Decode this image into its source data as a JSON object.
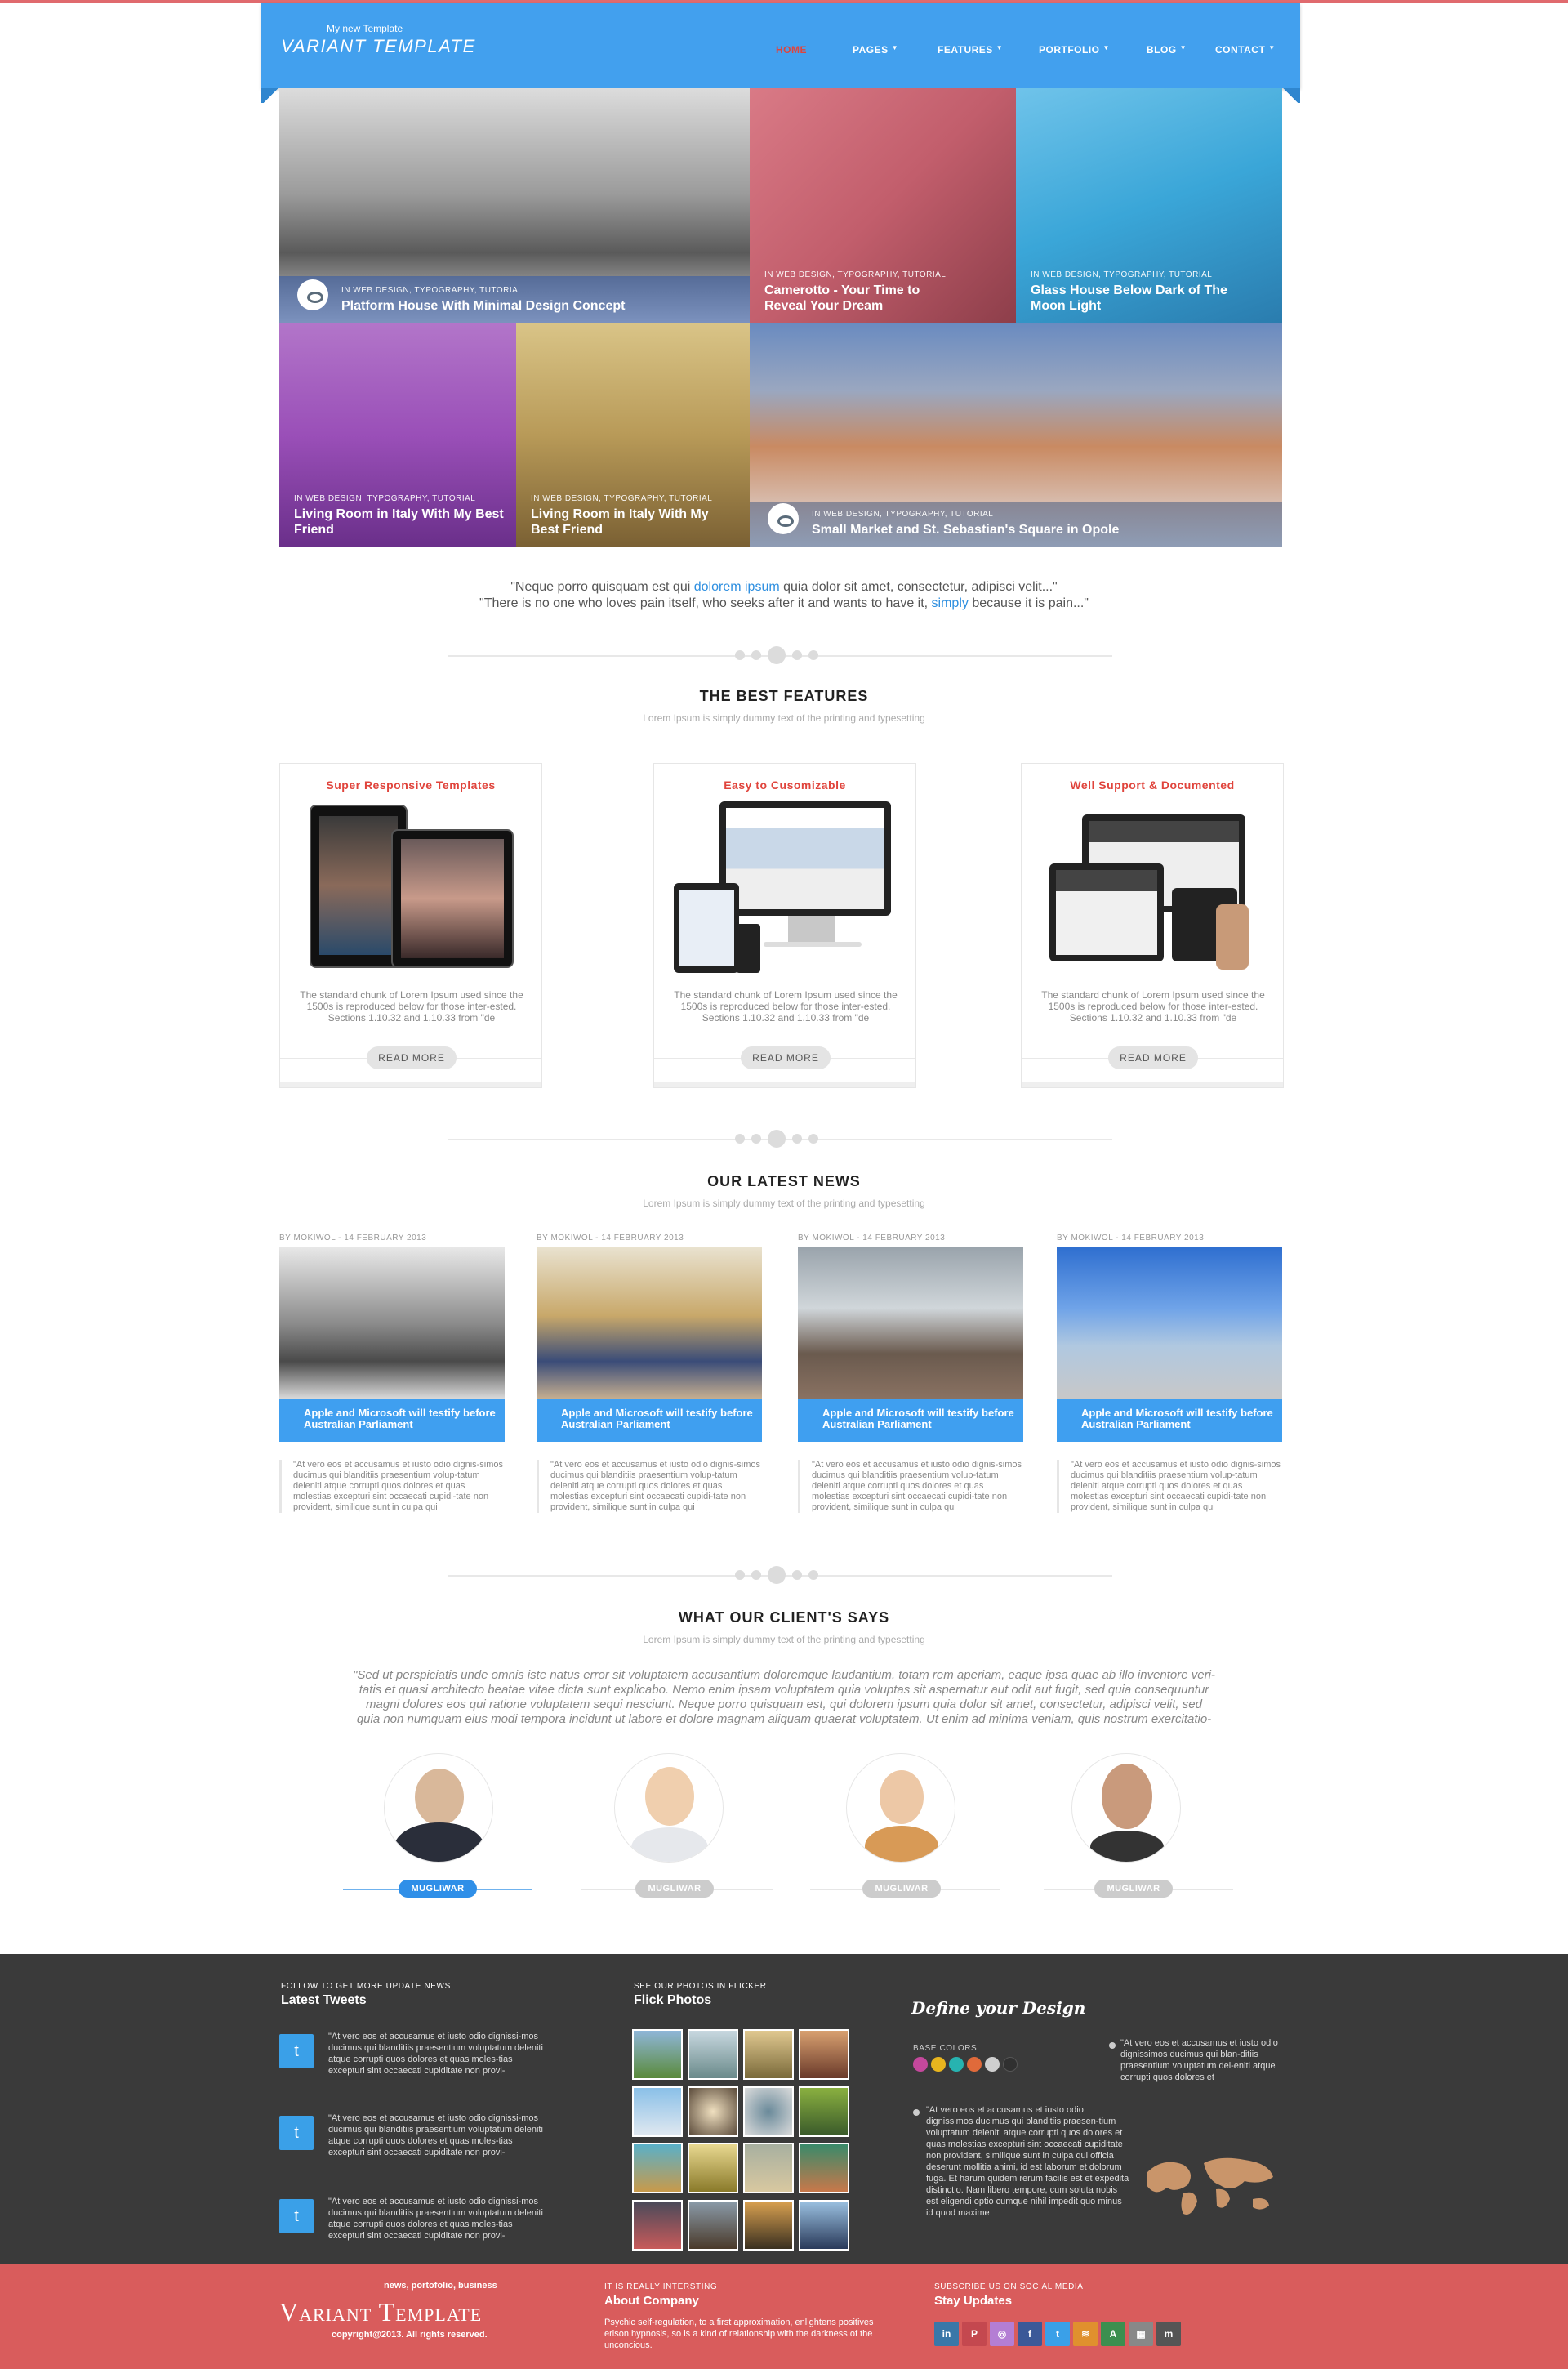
{
  "header": {
    "tagline": "My new Template",
    "logo": "VARIANT TEMPLATE",
    "nav": [
      "HOME",
      "PAGES",
      "FEATURES",
      "PORTFOLIO",
      "BLOG",
      "CONTACT"
    ]
  },
  "hero": [
    {
      "category": "IN WEB DESIGN, TYPOGRAPHY, TUTORIAL",
      "title": "Platform House With Minimal Design Concept"
    },
    {
      "category": "IN WEB DESIGN, TYPOGRAPHY, TUTORIAL",
      "title": "Camerotto - Your Time to Reveal Your Dream"
    },
    {
      "category": "IN WEB DESIGN, TYPOGRAPHY, TUTORIAL",
      "title": "Glass House Below Dark of The Moon Light"
    },
    {
      "category": "IN WEB DESIGN, TYPOGRAPHY, TUTORIAL",
      "title": "Living Room in Italy With My Best Friend"
    },
    {
      "category": "IN WEB DESIGN, TYPOGRAPHY, TUTORIAL",
      "title": "Living Room in Italy With My Best Friend"
    },
    {
      "category": "IN WEB DESIGN, TYPOGRAPHY, TUTORIAL",
      "title": "Small Market and St. Sebastian's Square in Opole"
    }
  ],
  "quote": {
    "line1_a": "\"Neque porro quisquam est qui ",
    "line1_hl": "dolorem ipsum",
    "line1_b": " quia dolor sit amet, consectetur, adipisci velit...\"",
    "line2_a": "\"There is no one who loves pain itself, who seeks after it and wants to have it, ",
    "line2_hl": "simply",
    "line2_b": " because it is pain...\""
  },
  "features": {
    "title": "THE BEST FEATURES",
    "subtitle": "Lorem Ipsum is simply dummy text of the printing and typesetting",
    "items": [
      {
        "title": "Super Responsive Templates",
        "text": "The standard chunk of Lorem Ipsum used since the 1500s is reproduced below for those inter-ested. Sections 1.10.32 and 1.10.33 from \"de",
        "button": "READ MORE"
      },
      {
        "title": "Easy to Cusomizable",
        "text": "The standard chunk of Lorem Ipsum used since the 1500s is reproduced below for those inter-ested. Sections 1.10.32 and 1.10.33 from \"de",
        "button": "READ MORE"
      },
      {
        "title": "Well Support & Documented",
        "text": "The standard chunk of Lorem Ipsum used since the 1500s is reproduced below for those inter-ested. Sections 1.10.32 and 1.10.33 from \"de",
        "button": "READ MORE"
      }
    ]
  },
  "news": {
    "title": "OUR LATEST NEWS",
    "subtitle": "Lorem Ipsum is simply dummy text of the printing and typesetting",
    "items": [
      {
        "meta": "BY MOKIWOL - 14 FEBRUARY 2013",
        "caption": "Apple and Microsoft will testify before Australian Parliament",
        "text": "\"At vero eos et accusamus et iusto odio dignis-simos ducimus qui blanditiis praesentium volup-tatum deleniti atque corrupti quos dolores et quas molestias excepturi sint occaecati cupidi-tate non provident, similique sunt in culpa qui"
      },
      {
        "meta": "BY MOKIWOL - 14 FEBRUARY 2013",
        "caption": "Apple and Microsoft will testify before Australian Parliament",
        "text": "\"At vero eos et accusamus et iusto odio dignis-simos ducimus qui blanditiis praesentium volup-tatum deleniti atque corrupti quos dolores et quas molestias excepturi sint occaecati cupidi-tate non provident, similique sunt in culpa qui"
      },
      {
        "meta": "BY MOKIWOL - 14 FEBRUARY 2013",
        "caption": "Apple and Microsoft will testify before Australian Parliament",
        "text": "\"At vero eos et accusamus et iusto odio dignis-simos ducimus qui blanditiis praesentium volup-tatum deleniti atque corrupti quos dolores et quas molestias excepturi sint occaecati cupidi-tate non provident, similique sunt in culpa qui"
      },
      {
        "meta": "BY MOKIWOL - 14 FEBRUARY 2013",
        "caption": "Apple and Microsoft will testify before Australian Parliament",
        "text": "\"At vero eos et accusamus et iusto odio dignis-simos ducimus qui blanditiis praesentium volup-tatum deleniti atque corrupti quos dolores et quas molestias excepturi sint occaecati cupidi-tate non provident, similique sunt in culpa qui"
      }
    ]
  },
  "clients": {
    "title": "WHAT OUR CLIENT'S SAYS",
    "subtitle": "Lorem Ipsum is simply dummy text of the printing and typesetting",
    "quote_lines": [
      "\"Sed ut perspiciatis unde omnis iste natus error sit voluptatem accusantium doloremque laudantium, totam rem aperiam, eaque ipsa quae ab illo inventore veri-",
      "tatis et quasi architecto beatae vitae dicta sunt explicabo. Nemo enim ipsam voluptatem quia voluptas sit aspernatur aut odit aut fugit, sed quia consequuntur",
      "magni dolores eos qui ratione voluptatem sequi nesciunt. Neque porro quisquam est, qui dolorem ipsum quia dolor sit amet, consectetur, adipisci velit, sed",
      "quia non numquam eius modi tempora incidunt ut labore et dolore magnam aliquam quaerat voluptatem. Ut enim ad minima veniam, quis nostrum exercitatio-"
    ],
    "names": [
      "MUGLIWAR",
      "MUGLIWAR",
      "MUGLIWAR",
      "MUGLIWAR"
    ]
  },
  "footer": {
    "tweets_small": "FOLLOW TO GET MORE UPDATE NEWS",
    "tweets_title": "Latest Tweets",
    "tweets": [
      "\"At vero eos et accusamus et iusto odio dignissi-mos ducimus qui blanditiis praesentium voluptatum deleniti atque corrupti quos dolores et quas moles-tias excepturi sint occaecati cupiditate non provi-",
      "\"At vero eos et accusamus et iusto odio dignissi-mos ducimus qui blanditiis praesentium voluptatum deleniti atque corrupti quos dolores et quas moles-tias excepturi sint occaecati cupiditate non provi-",
      "\"At vero eos et accusamus et iusto odio dignissi-mos ducimus qui blanditiis praesentium voluptatum deleniti atque corrupti quos dolores et quas moles-tias excepturi sint occaecati cupiditate non provi-"
    ],
    "photos_small": "SEE OUR PHOTOS IN FLICKER",
    "photos_title": "Flick Photos",
    "design_title": "Define your Design",
    "base_colors": "BASE COLORS",
    "swatches": [
      "#c4489c",
      "#e8b51e",
      "#27b3b0",
      "#e06a3a",
      "#cfcfcf",
      "#303030"
    ],
    "design_text_right": "\"At vero eos et accusamus et iusto odio dignissimos ducimus qui blan-ditiis praesentium voluptatum del-eniti atque corrupti quos dolores et",
    "design_text_left": "\"At vero eos et accusamus et iusto odio dignissimos ducimus qui blanditiis praesen-tium voluptatum deleniti atque corrupti quos dolores et quas molestias excepturi sint occaecati cupiditate non provident, similique sunt in culpa qui officia deserunt mollitia animi, id est laborum et dolorum fuga. Et harum quidem rerum facilis est et expedita distinctio. Nam libero tempore, cum soluta nobis est eligendi optio cumque nihil impedit quo minus id quod maxime",
    "red_tagline": "news, portofolio, business",
    "red_logo": "Variant Template",
    "copyright": "copyright@2013. All rights reserved.",
    "about_small": "IT IS REALLY INTERSTING",
    "about_title": "About Company",
    "about_text": "Psychic self-regulation, to a first approximation, enlightens positives erison hypnosis, so is a kind of relationship with the darkness of the unconcious.",
    "social_small": "SUBSCRIBE US ON SOCIAL MEDIA",
    "social_title": "Stay Updates",
    "social": [
      {
        "name": "linkedin",
        "glyph": "in",
        "color": "#3a77a8"
      },
      {
        "name": "pinterest",
        "glyph": "P",
        "color": "#c4484f"
      },
      {
        "name": "flickr",
        "glyph": "f",
        "color": "#2f5fa8"
      },
      {
        "name": "facebook",
        "glyph": "f",
        "color": "#3b5998"
      },
      {
        "name": "twitter",
        "glyph": "t",
        "color": "#3aa0e8"
      },
      {
        "name": "rss",
        "glyph": "r",
        "color": "#e0902e"
      },
      {
        "name": "vine",
        "glyph": "A",
        "color": "#3c8f4f"
      },
      {
        "name": "delicious",
        "glyph": "d",
        "color": "#888888"
      },
      {
        "name": "myspace",
        "glyph": "m",
        "color": "#555555"
      }
    ]
  }
}
